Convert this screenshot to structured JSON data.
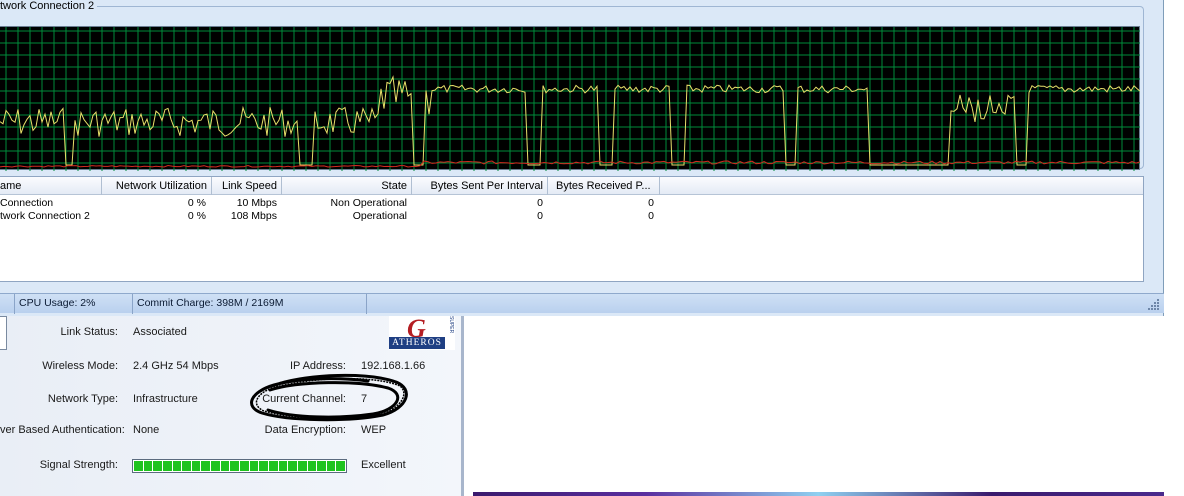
{
  "graph": {
    "label": "twork Connection 2"
  },
  "list": {
    "headers": [
      "ame",
      "Network Utilization",
      "Link Speed",
      "State",
      "Bytes Sent Per Interval",
      "Bytes Received P..."
    ],
    "rows": [
      [
        "Connection",
        "0 %",
        "10 Mbps",
        "Non Operational",
        "0",
        "0"
      ],
      [
        "twork Connection 2",
        "0 %",
        "108 Mbps",
        "Operational",
        "0",
        "0"
      ]
    ]
  },
  "statusbar": {
    "cpu": "CPU Usage: 2%",
    "commit": "Commit Charge: 398M / 2169M"
  },
  "atheros": {
    "logo_letter": "G",
    "logo_text": "ATHEROS",
    "logo_side_text": "SUPER",
    "link_status_label": "Link Status:",
    "link_status_value": "Associated",
    "wireless_mode_label": "Wireless Mode:",
    "wireless_mode_value": "2.4 GHz 54 Mbps",
    "ip_label": "IP Address:",
    "ip_value": "192.168.1.66",
    "network_type_label": "Network Type:",
    "network_type_value": "Infrastructure",
    "channel_label": "Current Channel:",
    "channel_value": "7",
    "auth_label": "ver Based Authentication:",
    "auth_value": "None",
    "encryption_label": "Data Encryption:",
    "encryption_value": "WEP",
    "signal_label": "Signal Strength:",
    "signal_value": "Excellent",
    "signal_level": 1.0,
    "signal_segments": 22
  },
  "colors": {
    "grid": "#008a3a",
    "trace": "#e8e06a",
    "trace2": "#d22a20",
    "signal": "#1ec31e"
  }
}
